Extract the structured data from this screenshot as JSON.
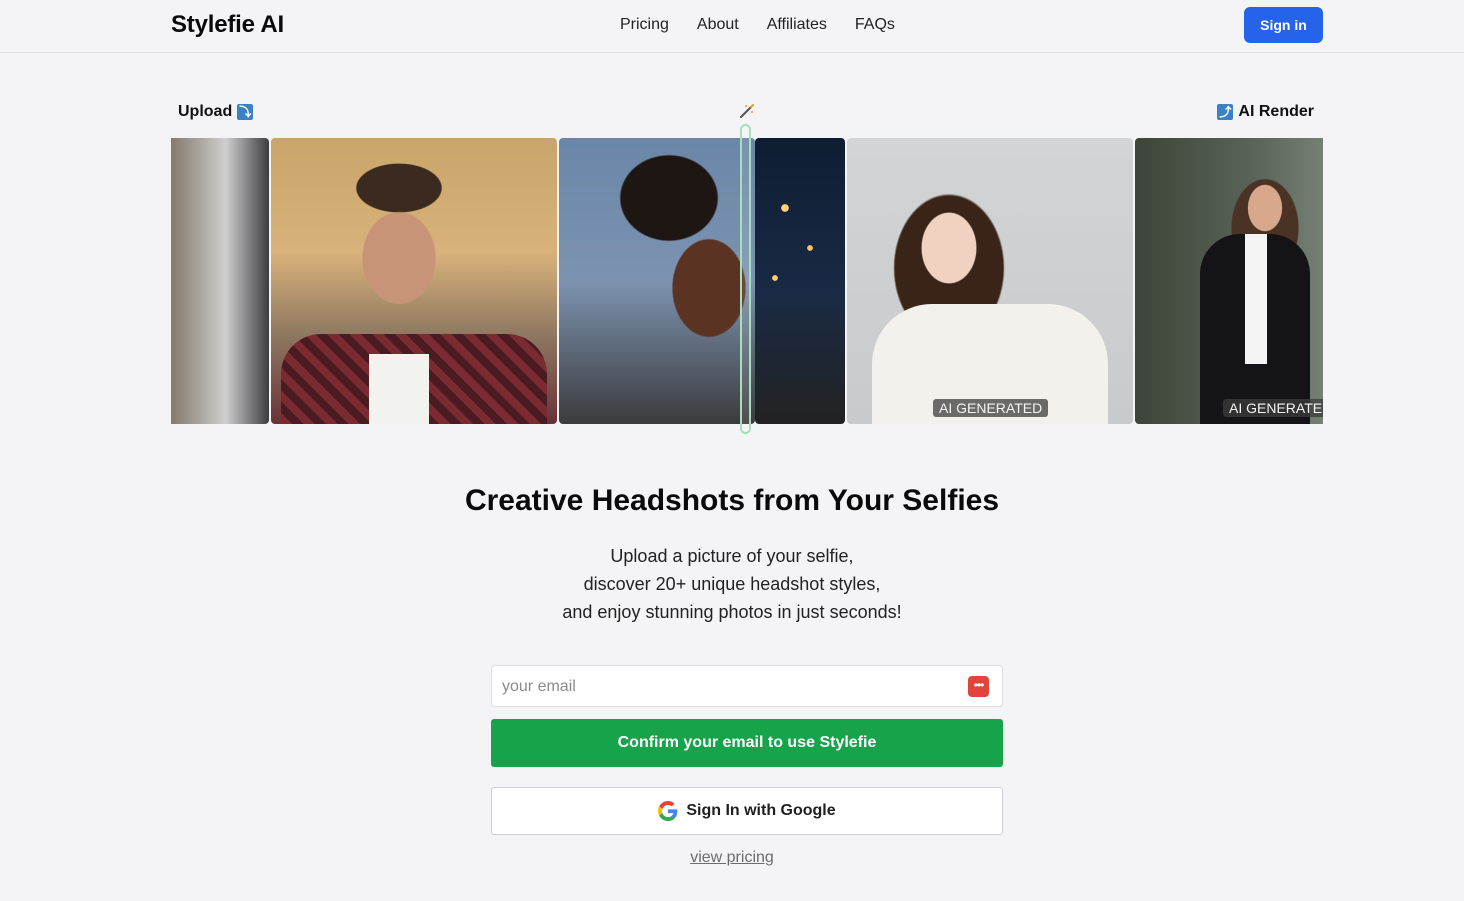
{
  "header": {
    "logo": "Stylefie AI",
    "nav": [
      "Pricing",
      "About",
      "Affiliates",
      "FAQs"
    ],
    "sign_in": "Sign in"
  },
  "strip": {
    "upload_label": "Upload",
    "upload_icon": "⤵",
    "render_label": "AI Render",
    "render_icon": "⤴",
    "ai_tag": "AI GENERATED"
  },
  "hero": {
    "title": "Creative Headshots from Your Selfies",
    "lines": [
      "Upload a picture of your selfie,",
      "discover 20+ unique headshot styles,",
      "and enjoy stunning photos in just seconds!"
    ]
  },
  "form": {
    "email_placeholder": "your email",
    "email_value": "",
    "confirm_label": "Confirm your email to use Stylefie",
    "google_label": "Sign In with Google",
    "view_pricing": "view pricing"
  },
  "colors": {
    "primary_blue": "#2563eb",
    "confirm_green": "#16a34a",
    "divider_green": "#a7dfba"
  }
}
